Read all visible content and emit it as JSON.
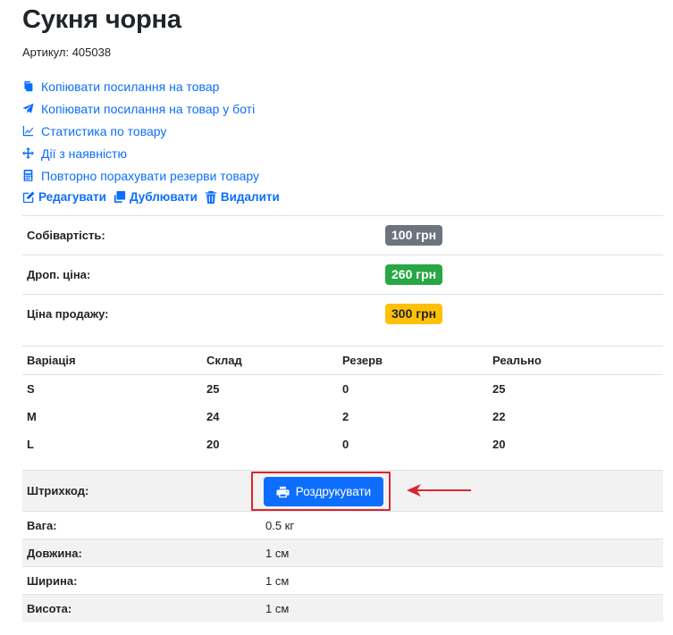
{
  "product": {
    "title": "Сукня чорна",
    "sku_text": "Артикул: 405038"
  },
  "links": [
    {
      "icon": "copy-icon",
      "label": "Копіювати посилання на товар"
    },
    {
      "icon": "telegram-icon",
      "label": "Копіювати посилання на товар у боті"
    },
    {
      "icon": "chart-line-icon",
      "label": "Статистика по товару"
    },
    {
      "icon": "arrows-move-icon",
      "label": "Дії з наявністю"
    },
    {
      "icon": "calculator-icon",
      "label": "Повторно порахувати резерви товару"
    }
  ],
  "actions": {
    "edit": "Редагувати",
    "duplicate": "Дублювати",
    "delete": "Видалити"
  },
  "prices": [
    {
      "label": "Собівартість:",
      "value": "100 грн",
      "color": "#6c757d"
    },
    {
      "label": "Дроп. ціна:",
      "value": "260 грн",
      "color": "#28a745"
    },
    {
      "label": "Ціна продажу:",
      "value": "300 грн",
      "color": "#ffc107"
    }
  ],
  "stock": {
    "headers": [
      "Варіація",
      "Склад",
      "Резерв",
      "Реально"
    ],
    "rows": [
      [
        "S",
        "25",
        "0",
        "25"
      ],
      [
        "M",
        "24",
        "2",
        "22"
      ],
      [
        "L",
        "20",
        "0",
        "20"
      ]
    ]
  },
  "specs": {
    "barcode_label": "Штрихкод:",
    "print_button": "Роздрукувати",
    "rows": [
      {
        "label": "Вага:",
        "value": "0.5 кг"
      },
      {
        "label": "Довжина:",
        "value": "1 см"
      },
      {
        "label": "Ширина:",
        "value": "1 см"
      },
      {
        "label": "Висота:",
        "value": "1 см"
      }
    ]
  },
  "colors": {
    "accent": "#0d6efd",
    "highlight_border": "#d9262c"
  }
}
